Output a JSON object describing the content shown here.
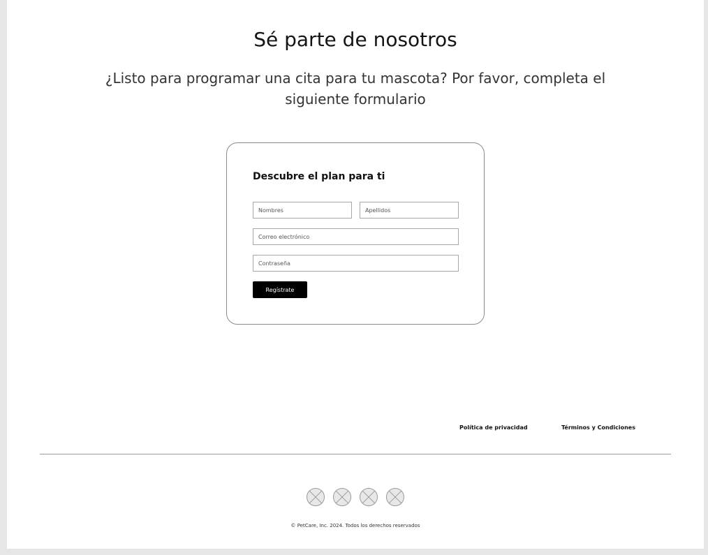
{
  "header": {
    "title": "Sé parte de nosotros",
    "subtitle": "¿Listo para programar una cita para tu mascota? Por favor, completa el siguiente formulario"
  },
  "form": {
    "title": "Descubre el plan para ti",
    "first_name_placeholder": "Nombres",
    "last_name_placeholder": "Apellidos",
    "email_placeholder": "Correo electrónico",
    "password_placeholder": "Contraseña",
    "submit_label": "Regístrate"
  },
  "footer": {
    "links": {
      "privacy": "Política de privacidad",
      "terms": "Términos y Condiciones"
    },
    "social_icons": [
      "social-icon-placeholder",
      "social-icon-placeholder",
      "social-icon-placeholder",
      "social-icon-placeholder"
    ],
    "copyright": "© PetCare, Inc. 2024. Todos los derechos reservados"
  },
  "colors": {
    "background": "#e6e6e6",
    "page": "#ffffff",
    "button": "#000000",
    "button_text": "#ffffff",
    "border": "#a8a8a8"
  }
}
